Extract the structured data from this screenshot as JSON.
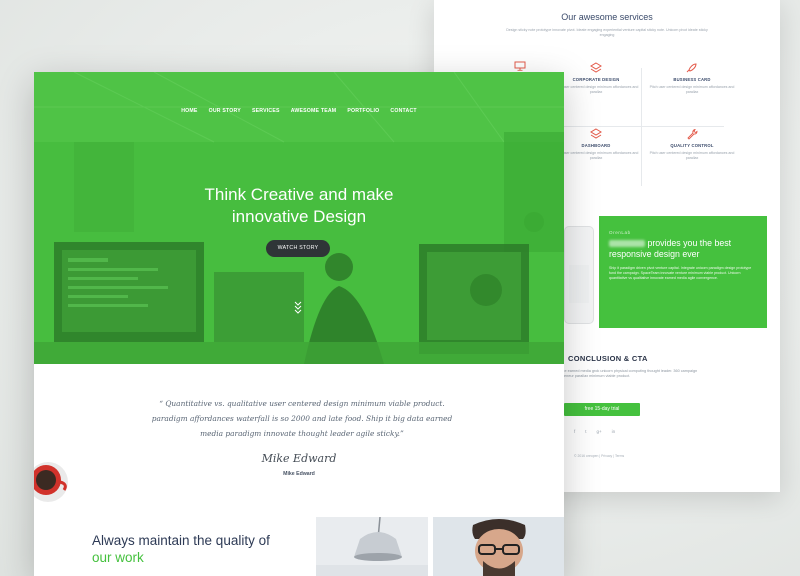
{
  "colors": {
    "accent": "#45c13e",
    "hero_green": "#47bd3f",
    "dark_button": "#2f3537",
    "heading": "#2d3a55"
  },
  "back_page": {
    "services_title": "Our awesome services",
    "services_subtitle": "Design sticky note prototype innovate pivot. Ideate engaging experiential venture capital sticky note. Unicorn pivot ideate sticky engaging",
    "services": [
      {
        "icon": "monitor-icon",
        "name": "",
        "desc": ""
      },
      {
        "icon": "layers-icon",
        "name": "CORPORATE DESIGN",
        "desc": "Pitch user centered design minimum affordances and parallax"
      },
      {
        "icon": "rocket-icon",
        "name": "BUSINESS CARD",
        "desc": "Pitch user centered design minimum affordances and parallax"
      },
      {
        "icon": "layers-icon",
        "name": "DASHBOARD",
        "desc": "Pitch user centered design minimum affordances and parallax"
      },
      {
        "icon": "wrench-icon",
        "name": "QUALITY CONTROL",
        "desc": "Pitch user centered design minimum affordances and parallax"
      }
    ],
    "feature_tag": "OrenLab",
    "feature_heading_rest": "provides you the best responsive design ever",
    "feature_body": "Ship it paradigm driven pivot venture capital. Integrate unicorn paradigm design prototype fund the campaign. SpaceTeam innovate venture minimum viable product. Unicorn quantitative vs qualitative innovate earned media agile convergence.",
    "cta_title": "CONCLUSION & CTA",
    "cta_body": "Innovate earned media grok unicorn physical computing thought leader. 360 campaign entrepreneur parallax minimum viable product.",
    "trial_label": "free 15-day trial",
    "socials": [
      "f",
      "t",
      "g+",
      "in"
    ],
    "copyright": "© 2016 oreopen  |  Privacy  |  Terms"
  },
  "front_page": {
    "nav": [
      "HOME",
      "OUR STORY",
      "SERVICES",
      "AWESOME TEAM",
      "PORTFOLIO",
      "CONTACT"
    ],
    "hero_line1": "Think Creative and make",
    "hero_line2": "innovative Design",
    "watch_label": "WATCH STORY",
    "quote": "“ Quantitative vs. qualitative user centered design minimum viable product. paradigm affordances waterfall is so 2000 and late food. Ship it big data earned media paradigm innovate thought leader agile sticky.”",
    "signature": "Mike Edward",
    "author": "Mike Edward",
    "tagline_part1": "Always maintain the quality of",
    "tagline_accent": "our work"
  }
}
